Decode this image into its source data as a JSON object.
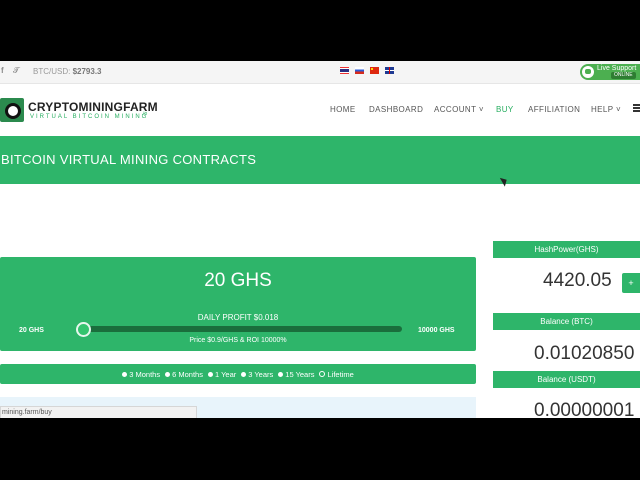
{
  "topbar": {
    "social_icons": [
      "facebook-icon",
      "twitter-icon"
    ],
    "btc_label": "BTC/USD:",
    "btc_value": "$2793.3",
    "languages": [
      "thai-flag-icon",
      "russian-flag-icon",
      "chinese-flag-icon",
      "english-flag-icon"
    ],
    "live_support": "Live Support",
    "live_status": "ONLINE"
  },
  "header": {
    "logo_title": "CRYPTOMININGFARM",
    "logo_sub": "VIRTUAL BITCOIN MINING",
    "logo_tld": ".io",
    "nav": [
      "HOME",
      "DASHBOARD",
      "ACCOUNT ˅",
      "BUY",
      "AFFILIATION",
      "HELP ˅"
    ],
    "active_nav": "BUY"
  },
  "title": "BITCOIN VIRTUAL MINING CONTRACTS",
  "slider": {
    "selected": "20 GHS",
    "daily_profit": "DAILY PROFIT $0.018",
    "min_label": "20 GHS",
    "max_label": "10000 GHS",
    "price": "Price $0.9/GHS & ROI 10000%",
    "position": 0
  },
  "durations": {
    "options": [
      "3 Months",
      "6 Months",
      "1 Year",
      "3 Years",
      "15 Years",
      "Lifetime"
    ],
    "selected": "Lifetime"
  },
  "status_url": "mining.farm/buy",
  "stats": {
    "hashpower_label": "HashPower(GHS)",
    "hashpower_value": "4420.05",
    "plus": "+",
    "balance_btc_label": "Balance (BTC)",
    "balance_btc_value": "0.01020850",
    "balance_usdt_label": "Balance (USDT)",
    "balance_usdt_value": "0.00000001"
  },
  "colors": {
    "accent": "#2eb56a",
    "text": "#333333",
    "bg": "#ffffff"
  }
}
